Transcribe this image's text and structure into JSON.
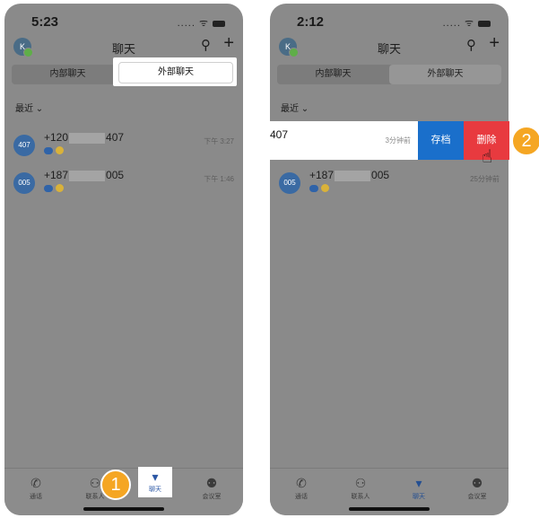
{
  "left": {
    "status": {
      "time": "5:23",
      "icons": "..... ᯤ"
    },
    "header": {
      "avatar": "K",
      "title": "聊天",
      "search": "⚲",
      "plus": "+"
    },
    "tabs": {
      "internal": "内部聊天",
      "external": "外部聊天"
    },
    "recent": "最近 ⌄",
    "rows": [
      {
        "avatar": "407",
        "num_a": "+120",
        "num_b": "407",
        "time": "下午 3:27"
      },
      {
        "avatar": "005",
        "num_a": "+187",
        "num_b": "005",
        "time": "下午 1:46"
      }
    ],
    "tabbar": {
      "calls": "通话",
      "contacts": "联系人",
      "chat": "聊天",
      "meeting": "会议室"
    }
  },
  "right": {
    "status": {
      "time": "2:12",
      "icons": "..... ᯤ"
    },
    "header": {
      "avatar": "K",
      "title": "聊天",
      "search": "⚲",
      "plus": "+"
    },
    "tabs": {
      "internal": "内部聊天",
      "external": "外部聊天"
    },
    "recent": "最近 ⌄",
    "swipe": {
      "fragment": "407",
      "ago": "3分钟前",
      "archive": "存档",
      "delete": "删除"
    },
    "rows": [
      {
        "avatar": "005",
        "num_a": "+187",
        "num_b": "005",
        "time": "25分钟前"
      }
    ],
    "tabbar": {
      "calls": "通话",
      "contacts": "联系人",
      "chat": "聊天",
      "meeting": "会议室"
    }
  },
  "badges": {
    "one": "1",
    "two": "2"
  },
  "colors": {
    "accent": "#2b57a5",
    "badge": "#f5a623",
    "archive": "#1a6fcb",
    "delete": "#e83a3f"
  }
}
